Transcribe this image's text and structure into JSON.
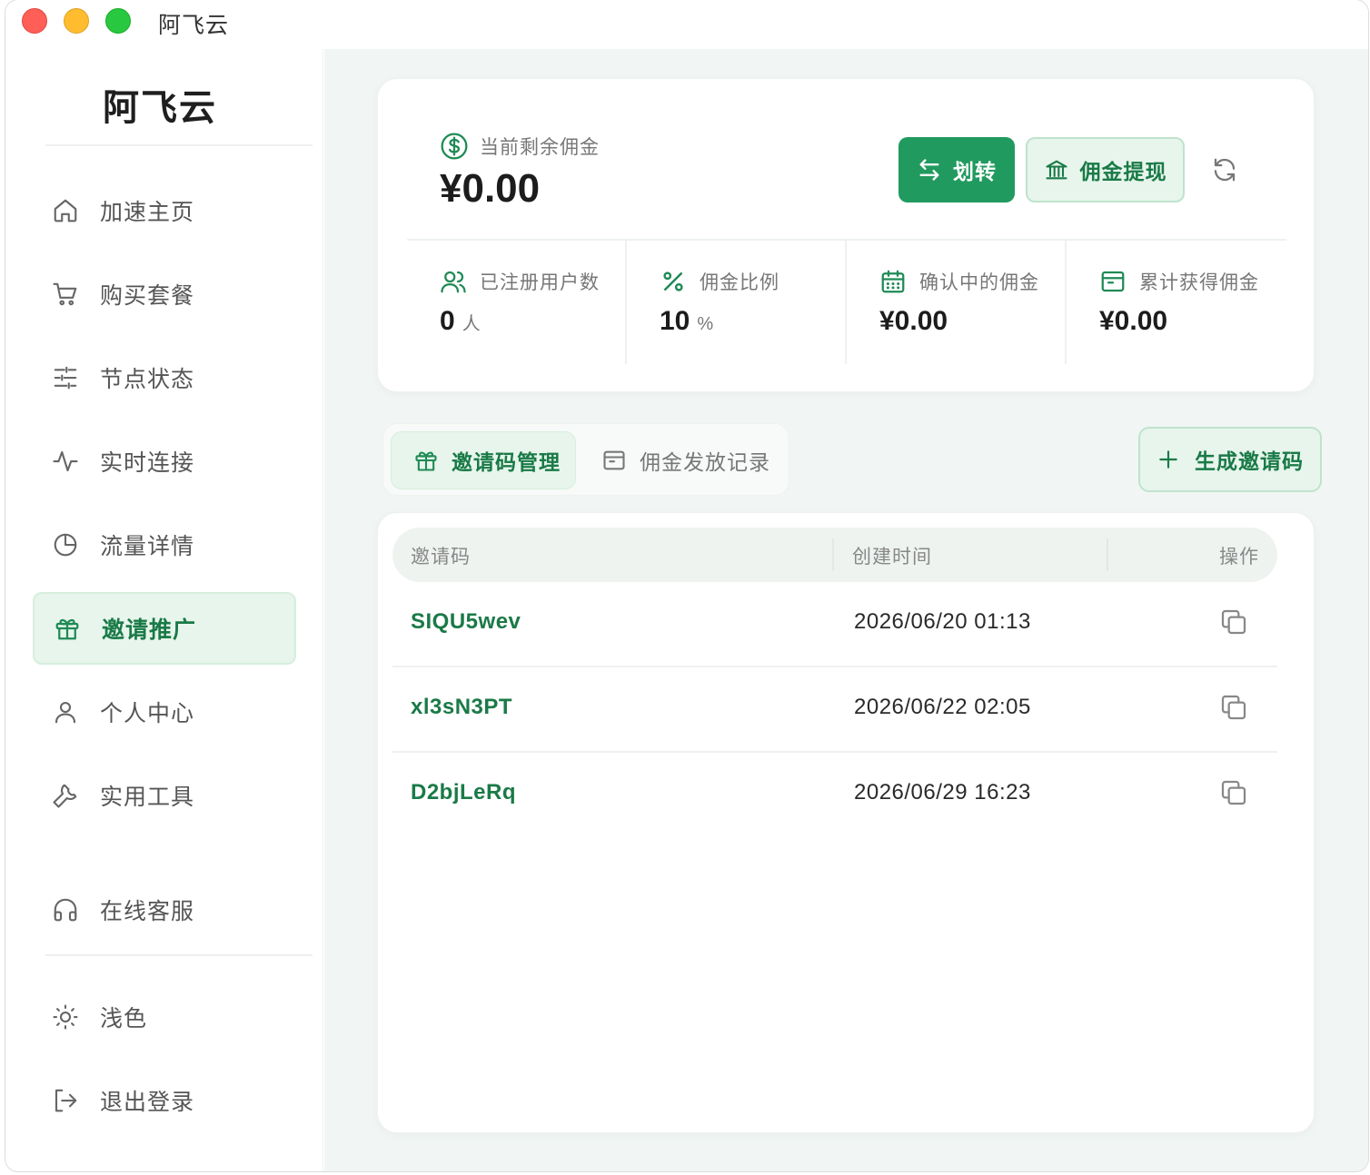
{
  "window": {
    "title": "阿飞云"
  },
  "sidebar": {
    "brand": "阿飞云",
    "items": [
      {
        "label": "加速主页",
        "icon": "home-icon"
      },
      {
        "label": "购买套餐",
        "icon": "cart-icon"
      },
      {
        "label": "节点状态",
        "icon": "sliders-icon"
      },
      {
        "label": "实时连接",
        "icon": "activity-icon"
      },
      {
        "label": "流量详情",
        "icon": "pie-chart-icon"
      },
      {
        "label": "邀请推广",
        "icon": "gift-icon",
        "active": true
      },
      {
        "label": "个人中心",
        "icon": "user-icon"
      },
      {
        "label": "实用工具",
        "icon": "wrench-icon"
      }
    ],
    "support": {
      "label": "在线客服",
      "icon": "headphones-icon"
    },
    "theme": {
      "label": "浅色",
      "icon": "sun-icon"
    },
    "logout": {
      "label": "退出登录",
      "icon": "logout-icon"
    }
  },
  "commission": {
    "balance_label": "当前剩余佣金",
    "balance_value": "¥0.00",
    "transfer_label": "划转",
    "withdraw_label": "佣金提现",
    "stats": [
      {
        "label": "已注册用户数",
        "value": "0",
        "unit": "人",
        "icon": "users-icon"
      },
      {
        "label": "佣金比例",
        "value": "10",
        "unit": "%",
        "icon": "percent-icon"
      },
      {
        "label": "确认中的佣金",
        "value": "¥0.00",
        "unit": "",
        "icon": "calendar-icon"
      },
      {
        "label": "累计获得佣金",
        "value": "¥0.00",
        "unit": "",
        "icon": "wallet-icon"
      }
    ]
  },
  "tabs": {
    "invite_codes": "邀请码管理",
    "payout_records": "佣金发放记录"
  },
  "generate_label": "生成邀请码",
  "table": {
    "headers": {
      "code": "邀请码",
      "created": "创建时间",
      "actions": "操作"
    },
    "rows": [
      {
        "code": "SIQU5wev",
        "created": "2026/06/20 01:13"
      },
      {
        "code": "xl3sN3PT",
        "created": "2026/06/22 02:05"
      },
      {
        "code": "D2bjLeRq",
        "created": "2026/06/29 16:23"
      }
    ]
  },
  "colors": {
    "accent": "#219a5f",
    "accent_light": "#e7f5ec",
    "accent_text": "#1a7a47",
    "main_bg": "#f1f6f4"
  }
}
